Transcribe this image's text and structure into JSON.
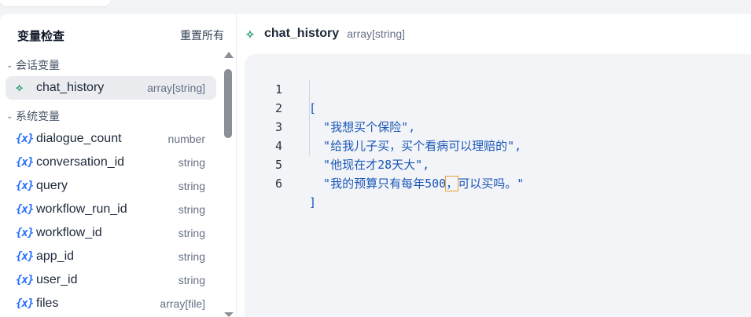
{
  "sidebar": {
    "title": "变量检查",
    "reset_label": "重置所有",
    "conversation_group": {
      "label": "会话变量",
      "items": [
        {
          "name": "chat_history",
          "type": "array[string]"
        }
      ]
    },
    "system_group": {
      "label": "系统变量",
      "items": [
        {
          "name": "dialogue_count",
          "type": "number"
        },
        {
          "name": "conversation_id",
          "type": "string"
        },
        {
          "name": "query",
          "type": "string"
        },
        {
          "name": "workflow_run_id",
          "type": "string"
        },
        {
          "name": "workflow_id",
          "type": "string"
        },
        {
          "name": "app_id",
          "type": "string"
        },
        {
          "name": "user_id",
          "type": "string"
        },
        {
          "name": "files",
          "type": "array[file]"
        }
      ]
    },
    "system_icon_text": "{x}"
  },
  "main": {
    "variable_name": "chat_history",
    "variable_type": "array[string]",
    "code_lines": [
      {
        "num": "1",
        "text": "["
      },
      {
        "num": "2",
        "text": "  \"我想买个保险\","
      },
      {
        "num": "3",
        "text": "  \"给我儿子买，买个看病可以理赔的\","
      },
      {
        "num": "4",
        "text": "  \"他现在才28天大\","
      },
      {
        "num": "5",
        "text_before": "  \"我的预算只有每年500",
        "text_cursor": "，",
        "text_after": "可以买吗。\""
      },
      {
        "num": "6",
        "text": "]"
      }
    ]
  },
  "icons": {
    "conversation_variable": "conversation-variable-icon",
    "system_variable": "system-variable-icon"
  },
  "colors": {
    "accent_blue": "#2970ff",
    "conversation_green": "#2d9d78",
    "code_string": "#1a56b8"
  }
}
